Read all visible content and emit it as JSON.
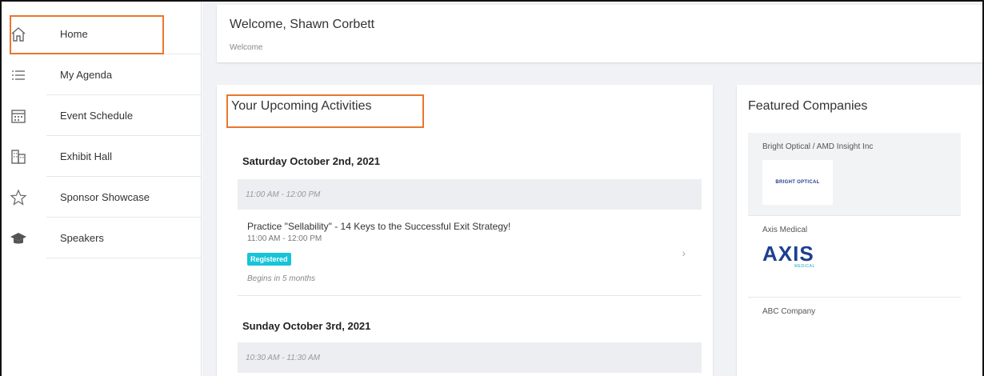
{
  "sidebar": {
    "items": [
      {
        "label": "Home",
        "icon": "home-icon"
      },
      {
        "label": "My Agenda",
        "icon": "list-icon"
      },
      {
        "label": "Event Schedule",
        "icon": "calendar-icon"
      },
      {
        "label": "Exhibit Hall",
        "icon": "building-icon"
      },
      {
        "label": "Sponsor Showcase",
        "icon": "star-icon"
      },
      {
        "label": "Speakers",
        "icon": "graduation-cap-icon"
      }
    ]
  },
  "welcome": {
    "title": "Welcome, Shawn Corbett",
    "subtitle": "Welcome"
  },
  "activities": {
    "title": "Your Upcoming Activities",
    "days": [
      {
        "date": "Saturday October 2nd, 2021",
        "time_range": "11:00 AM - 12:00 PM",
        "sessions": [
          {
            "title": "Practice \"Sellability\" - 14 Keys to the Successful Exit Strategy!",
            "time": "11:00 AM - 12:00 PM",
            "status": "Registered",
            "note": "Begins in 5 months"
          }
        ]
      },
      {
        "date": "Sunday October 3rd, 2021",
        "time_range": "10:30 AM - 11:30 AM"
      }
    ]
  },
  "featured": {
    "title": "Featured Companies",
    "companies": [
      {
        "name": "Bright Optical / AMD Insight Inc",
        "logo_text": "BRIGHT OPTICAL"
      },
      {
        "name": "Axis Medical",
        "logo_text": "AXIS",
        "logo_subtext": "MEDICAL"
      },
      {
        "name": "ABC Company"
      }
    ]
  },
  "colors": {
    "accent_highlight": "#e8772e",
    "badge": "#17c4d8",
    "axis_blue": "#1d3f8f"
  }
}
